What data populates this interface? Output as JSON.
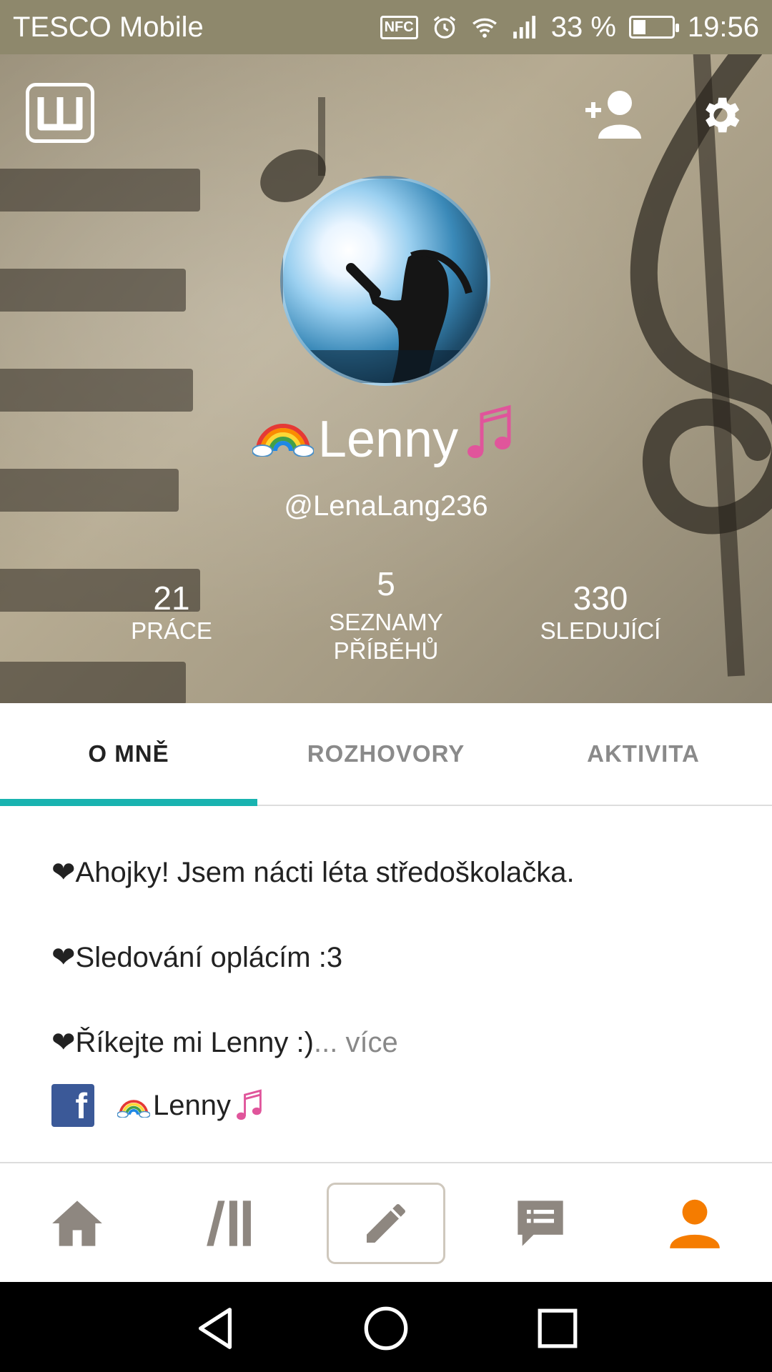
{
  "status_bar": {
    "carrier": "TESCO Mobile",
    "nfc": "NFC",
    "battery": "33 %",
    "battery_level": 0.33,
    "time": "19:56",
    "icons": [
      "nfc-icon",
      "alarm-icon",
      "wifi-icon",
      "signal-icon",
      "battery-icon"
    ]
  },
  "header": {
    "logo": "w",
    "display_name": "Lenny",
    "handle": "@LenaLang236",
    "stats": [
      {
        "value": "21",
        "label": "PRÁCE"
      },
      {
        "value": "5",
        "label": "SEZNAMY PŘÍBĚHŮ"
      },
      {
        "value": "330",
        "label": "SLEDUJÍCÍ"
      }
    ]
  },
  "tabs": [
    {
      "label": "O MNĚ",
      "active": true
    },
    {
      "label": "ROZHOVORY",
      "active": false
    },
    {
      "label": "AKTIVITA",
      "active": false
    }
  ],
  "about": {
    "heart": "❤",
    "lines": [
      "Ahojky! Jsem nácti léta středoškolačka.",
      "Sledování oplácím :3",
      "Říkejte mi Lenny :)"
    ],
    "more": "... více",
    "facebook_name": "Lenny"
  },
  "bottom_nav": [
    {
      "icon": "home-icon"
    },
    {
      "icon": "library-icon"
    },
    {
      "icon": "pencil-icon"
    },
    {
      "icon": "messages-icon"
    },
    {
      "icon": "profile-icon",
      "active": true
    }
  ],
  "colors": {
    "accent_teal": "#19b3b0",
    "active_orange": "#f57c00",
    "nav_gray": "#8e8780",
    "facebook": "#3b5998"
  }
}
